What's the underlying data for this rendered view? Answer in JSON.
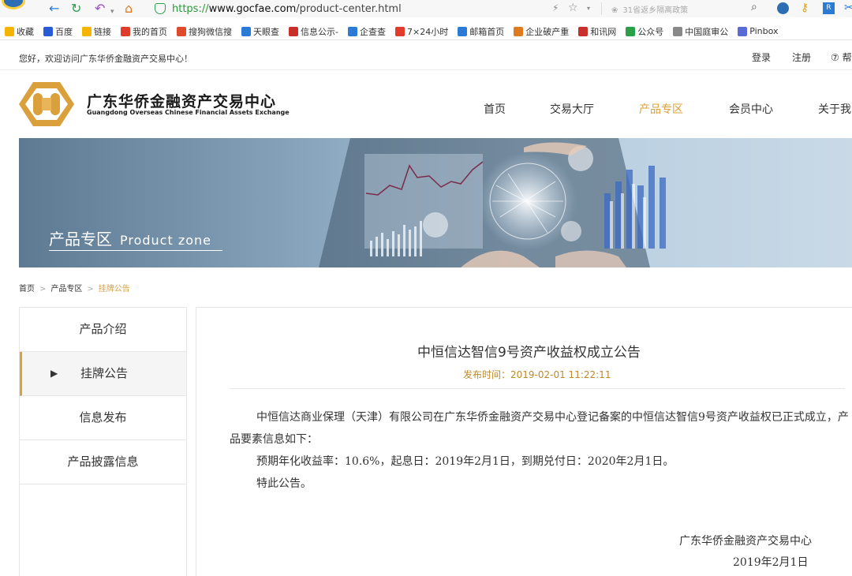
{
  "browser": {
    "url_protocol": "https://",
    "url_host": "www.gocfae.com",
    "url_path": "/product-center.html",
    "search_placeholder": "31省返乡隔离政策",
    "bookmarks": [
      {
        "label": "收藏",
        "color": "#f5b400",
        "icon": "star-icon"
      },
      {
        "label": "百度",
        "color": "#2a5bd7",
        "icon": "baidu-icon"
      },
      {
        "label": "链接",
        "color": "#f5b400",
        "icon": "folder-icon"
      },
      {
        "label": "我的首页",
        "color": "#e03b2b",
        "icon": "weibo-icon"
      },
      {
        "label": "搜狗微信搜",
        "color": "#e04b2b",
        "icon": "sogou-icon"
      },
      {
        "label": "天眼查",
        "color": "#2a7bd6",
        "icon": "tianyancha-icon"
      },
      {
        "label": "信息公示-",
        "color": "#c9302c",
        "icon": "gsxt-icon"
      },
      {
        "label": "企查查",
        "color": "#2a7bd6",
        "icon": "qichacha-icon"
      },
      {
        "label": "7×24小时",
        "color": "#e03b2b",
        "icon": "weibo-icon"
      },
      {
        "label": "邮箱首页",
        "color": "#2a7bd6",
        "icon": "mail-icon"
      },
      {
        "label": "企业破产重",
        "color": "#e07a1f",
        "icon": "bankruptcy-icon"
      },
      {
        "label": "和讯网",
        "color": "#c9302c",
        "icon": "hexun-icon"
      },
      {
        "label": "公众号",
        "color": "#2aa04a",
        "icon": "wechat-icon"
      },
      {
        "label": "中国庭审公",
        "color": "#888888",
        "icon": "page-icon"
      },
      {
        "label": "Pinbox",
        "color": "#5a6bd6",
        "icon": "pinbox-icon"
      }
    ]
  },
  "site": {
    "welcome": "您好，欢迎访问广东华侨金融资产交易中心！",
    "login": "登录",
    "register": "注册",
    "help": "⑦ 帮",
    "logo_cn": "广东华侨金融资产交易中心",
    "logo_en": "Guangdong Overseas Chinese Financial Assets Exchange",
    "nav": [
      "首页",
      "交易大厅",
      "产品专区",
      "会员中心",
      "关于我"
    ],
    "active_nav_index": 2,
    "accent_color": "#d9a03c"
  },
  "banner": {
    "title_cn": "产品专区",
    "title_en": "Product zone"
  },
  "breadcrumb": {
    "items": [
      "首页",
      "产品专区",
      "挂牌公告"
    ],
    "separator": ">"
  },
  "sidebar": {
    "items": [
      "产品介绍",
      "挂牌公告",
      "信息发布",
      "产品披露信息"
    ],
    "active_index": 1
  },
  "article": {
    "title": "中恒信达智信9号资产收益权成立公告",
    "date": "发布时间：2019-02-01 11:22:11",
    "para1": "中恒信达商业保理（天津）有限公司在广东华侨金融资产交易中心登记备案的中恒信达智信9号资产收益权已正式成立，产品要素信息如下：",
    "para2": "预期年化收益率：10.6%，起息日：2019年2月1日，到期兑付日：2020年2月1日。",
    "para3": "特此公告。",
    "signature": "广东华侨金融资产交易中心",
    "sign_date": "2019年2月1日"
  }
}
